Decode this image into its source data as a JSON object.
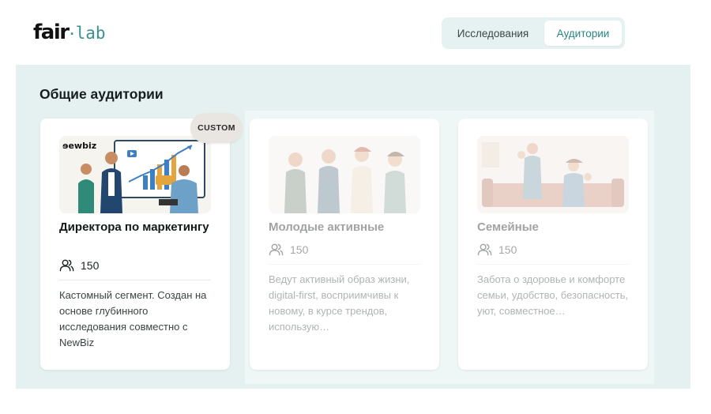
{
  "brand": {
    "word": "fair",
    "dot": "·",
    "suffix": "lab"
  },
  "tabs": [
    {
      "label": "Исследования",
      "active": false
    },
    {
      "label": "Аудитории",
      "active": true
    }
  ],
  "section": {
    "title": "Общие аудитории"
  },
  "cards": [
    {
      "title": "Директора по маркетингу",
      "count": "150",
      "description": "Кастомный сегмент. Создан на основе глубинного исследования совместно с NewBiz",
      "badge": "CUSTOM",
      "image_label": "ɘewbiz",
      "image_icon": "marketing-team-illustration"
    },
    {
      "title": "Молодые активные",
      "count": "150",
      "description": "Ведут активный образ жизни, digital-first, восприимчивы к новому, в курсе трендов, использую…",
      "image_icon": "young-people-illustration"
    },
    {
      "title": "Семейные",
      "count": "150",
      "description": "Забота о здоровье и комфорте семьи, удобство, безопасность, уют, совместное…",
      "image_icon": "family-illustration"
    }
  ],
  "colors": {
    "accent": "#2b8585",
    "panel_bg": "#e5f1f1",
    "tab_bar_bg": "#e6f2f2",
    "badge_bg": "#e9e6e2"
  }
}
